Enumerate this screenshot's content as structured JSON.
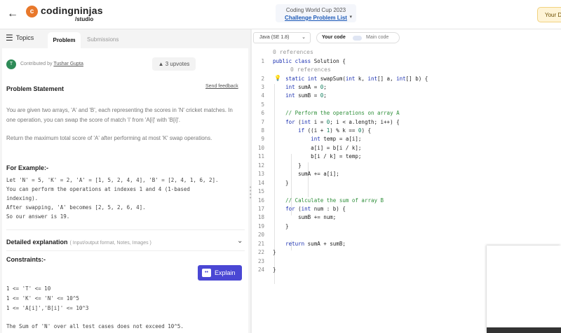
{
  "topbar": {
    "back_glyph": "←",
    "logo_mark": "c",
    "logo_text": "codingninjas",
    "logo_sub": "/studio",
    "event_title": "Coding World Cup 2023",
    "event_link": "Challenge Problem List",
    "your_button": "Your D"
  },
  "tabs": {
    "topics": "Topics",
    "problem": "Problem",
    "submissions": "Submissions"
  },
  "problem": {
    "avatar_letter": "T",
    "contributed_by": "Contributed by",
    "contributor": "Tushar Gupta",
    "upvotes": "3 upvotes",
    "statement_title": "Problem Statement",
    "send_feedback": "Send feedback",
    "para1": "You are given two arrays, 'A' and 'B', each representing the scores in 'N' cricket matches. In one operation, you can swap the score of match 'i' from 'A[i]' with 'B[i]'.",
    "para2": "Return the maximum total score of 'A' after performing at most 'K' swap operations.",
    "example_title": "For Example:-",
    "example_lines": [
      "Let 'N' = 5, 'K' = 2, 'A' = [1, 5, 2, 4, 4], 'B' = [2, 4, 1, 6, 2].",
      "You can perform the operations at indexes 1 and 4 (1-based",
      "indexing).",
      "After swapping, 'A' becomes [2, 5, 2, 6, 4].",
      "So our answer is 19."
    ],
    "detailed_title": "Detailed explanation",
    "detailed_sub": "( Input/output format, Notes, Images )",
    "constraints_title": "Constraints:-",
    "explain_label": "Explain",
    "constraint_lines": [
      "1 <= 'T' <= 10",
      "1 <= 'K' <= 'N' <= 10^5",
      "1 <= 'A[i]','B[i]' <= 10^3"
    ],
    "footer_line": "The Sum of 'N' over all test cases does not exceed 10^5."
  },
  "editor": {
    "language": "Java (SE 1.8)",
    "your_code": "Your code",
    "main_code": "Main code",
    "references": "0 references",
    "line_numbers": [
      "1",
      "2",
      "3",
      "4",
      "5",
      "6",
      "7",
      "8",
      "9",
      "10",
      "11",
      "12",
      "13",
      "14",
      "15",
      "16",
      "17",
      "18",
      "19",
      "20",
      "21",
      "22",
      "23",
      "24"
    ]
  }
}
